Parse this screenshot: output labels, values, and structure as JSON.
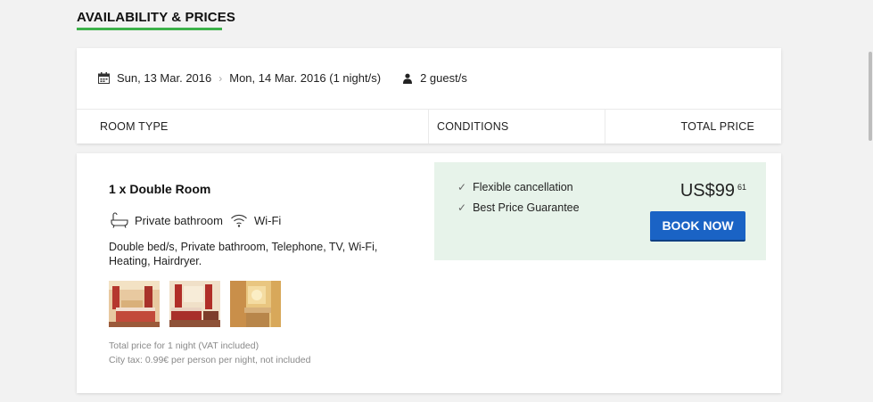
{
  "section": {
    "title": "AVAILABILITY & PRICES"
  },
  "search": {
    "checkin": "Sun, 13 Mar. 2016",
    "checkout": "Mon, 14 Mar. 2016 (1 night/s)",
    "guests": "2 guest/s"
  },
  "table": {
    "col_room_type": "ROOM TYPE",
    "col_conditions": "CONDITIONS",
    "col_total_price": "TOTAL PRICE"
  },
  "room": {
    "name": "1 x Double Room",
    "amenities": [
      "Private bathroom",
      "Wi-Fi"
    ],
    "description": "Double bed/s, Private bathroom, Telephone, TV, Wi-Fi, Heating, Hairdryer.",
    "thumbnails": [
      "room-photo-1",
      "room-photo-2",
      "room-photo-3"
    ],
    "note_total": "Total price for 1 night (VAT included)",
    "note_tax": "City tax: 0.99€ per person per night, not included",
    "conditions": [
      "Flexible cancellation",
      "Best Price Guarantee"
    ],
    "price_main": "US$99",
    "price_cents": "61",
    "book_label": "BOOK NOW"
  },
  "colors": {
    "accent_green": "#3cb14a",
    "button_blue": "#1a63c5",
    "price_box_bg": "#e7f3ea"
  }
}
